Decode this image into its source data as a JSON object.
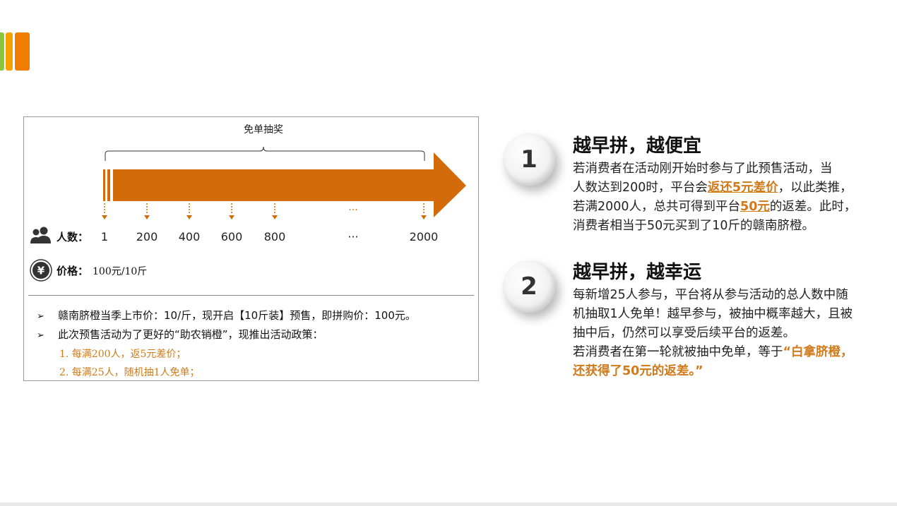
{
  "colors": {
    "accent": "#d36b0a",
    "policy_text": "#d07a1a",
    "corner_green": "#8cc63f",
    "corner_yellow": "#f7a100",
    "corner_orange": "#f07c00"
  },
  "diagram": {
    "bracket_label": "免单抽奖",
    "people_label": "人数：",
    "people_icon": "people-icon",
    "ticks": [
      "1",
      "200",
      "400",
      "600",
      "800",
      "···",
      "2000"
    ],
    "price_label": "价格：",
    "price_value": "100元/10斤",
    "price_icon": "yen-coin-icon",
    "bullets": [
      "赣南脐橙当季上市价：10/斤，现开启【10斤装】预售，即拼购价：100元。",
      "此次预售活动为了更好的“助农销橙”，现推出活动政策："
    ],
    "policies": [
      "1. 每满200人，返5元差价；",
      "2. 每满25人，随机抽1人免单；"
    ]
  },
  "section1": {
    "number": "1",
    "title": "越早拼，越便宜",
    "line1": "若消费者在活动刚开始时参与了此预售活动，当",
    "line2_a": "人数达到200时，平台会",
    "line2_hl": "返还5元差价",
    "line2_b": "，以此类推，",
    "line3_a": "若满2000人，总共可得到平台",
    "line3_hl": "50元",
    "line3_b": "的返差。此时，",
    "line4": "消费者相当于50元买到了10斤的赣南脐橙。"
  },
  "section2": {
    "number": "2",
    "title": "越早拼，越幸运",
    "line1": "每新增25人参与，平台将从参与活动的总人数中随",
    "line2": "机抽取1人免单！越早参与，被抽中概率越大，且被",
    "line3": "抽中后，仍然可以享受后续平台的返差。",
    "line4_a": "若消费者在第一轮就被抽中免单，等于",
    "line4_hl": "“白拿脐橙，",
    "line5_hl": "还获得了50元的返差。”"
  }
}
